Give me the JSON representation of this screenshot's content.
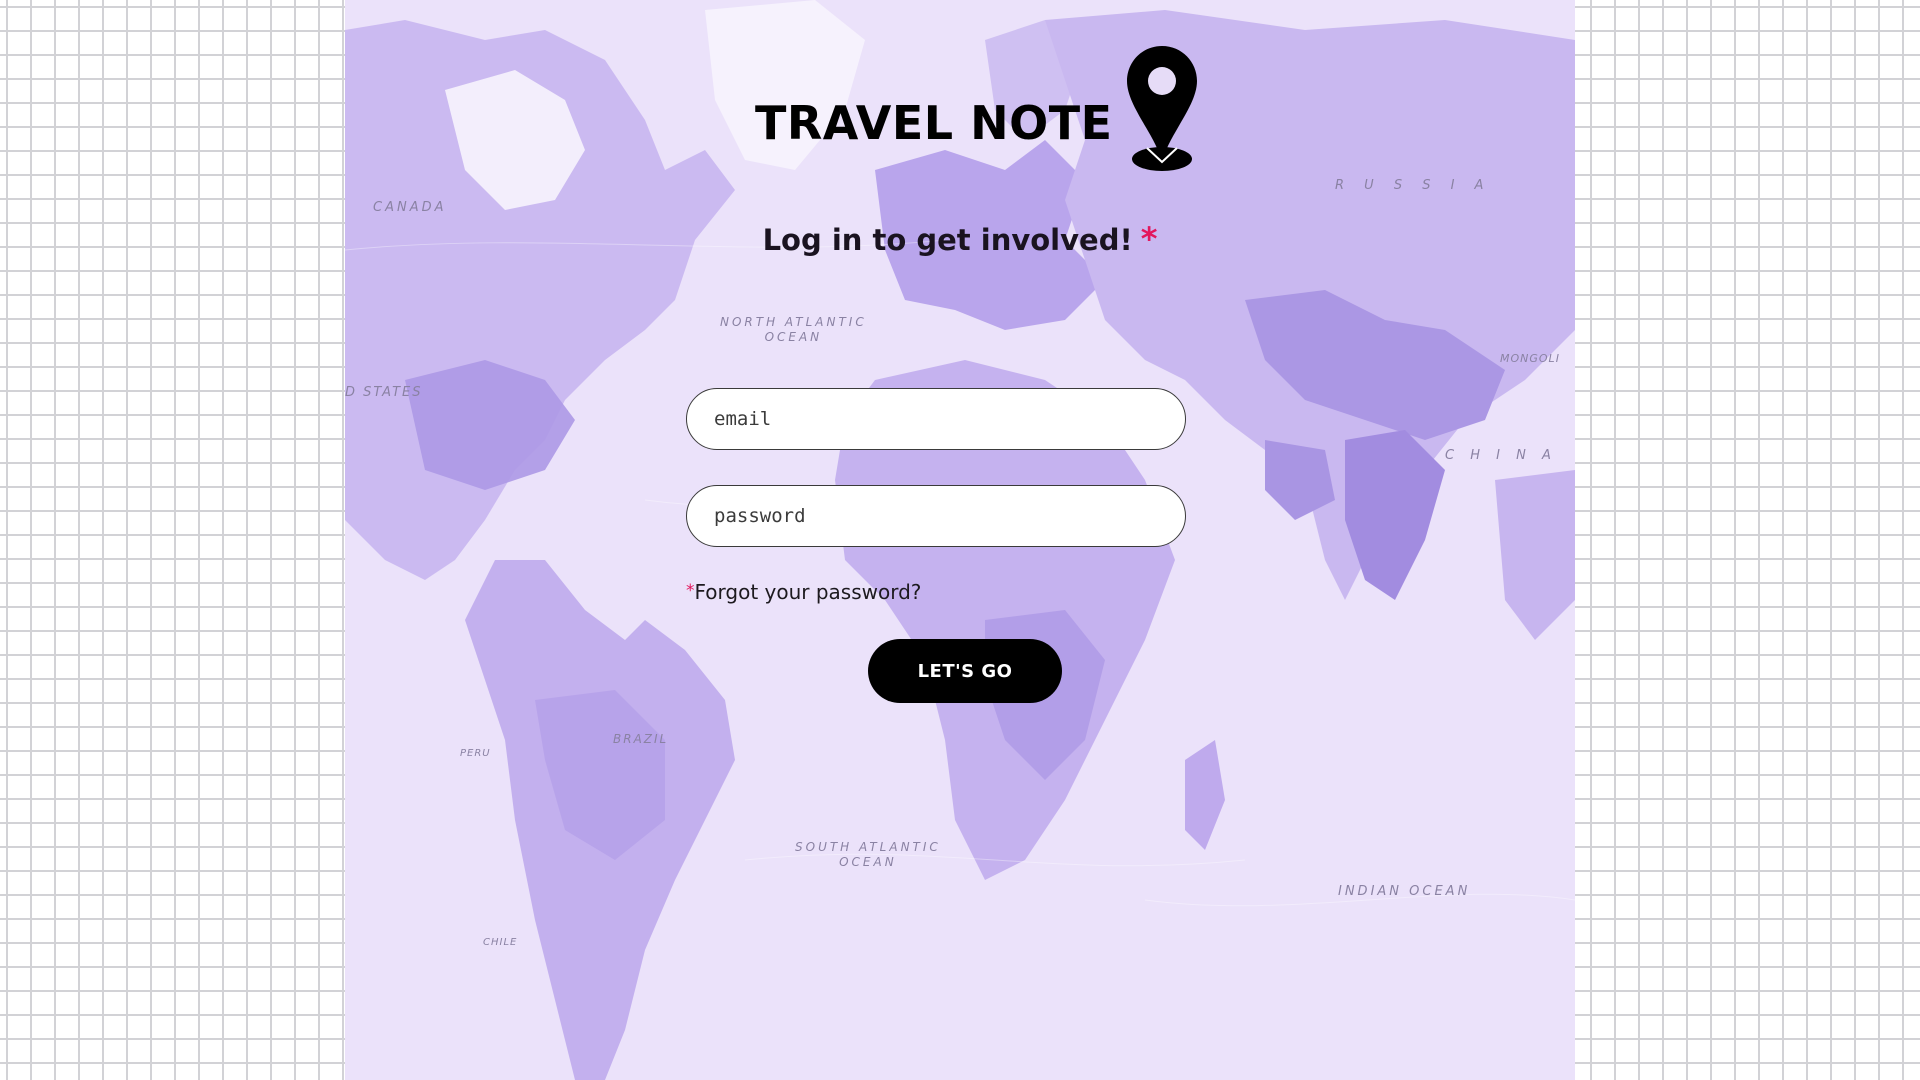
{
  "brand": {
    "title": "TRAVEL NOTE",
    "pin_icon": "map-pin-icon"
  },
  "login": {
    "subtitle": "Log in to get involved!",
    "required_marker": "*",
    "email_placeholder": "email",
    "password_placeholder": "password",
    "forgot_marker": "*",
    "forgot_label": "Forgot your password?",
    "submit_label": "LET'S GO"
  },
  "map": {
    "labels": {
      "canada": "CANADA",
      "united_states": "D STATES",
      "russia": "R U S S I A",
      "china": "C H I N A",
      "mongolia": "MONGOLI",
      "north_atlantic": "NORTH ATLANTIC\nOCEAN",
      "brazil": "BRAZIL",
      "peru": "PERU",
      "south_atlantic": "SOUTH ATLANTIC\nOCEAN",
      "indian_ocean": "INDIAN OCEAN",
      "chile": "CHILE"
    }
  },
  "colors": {
    "map_background": "#e9dff9",
    "land": "#c8b6ef",
    "land_dark": "#a994e2",
    "accent_star": "#e3175c",
    "button": "#000000",
    "grid_lines": "#d2d2d6"
  }
}
